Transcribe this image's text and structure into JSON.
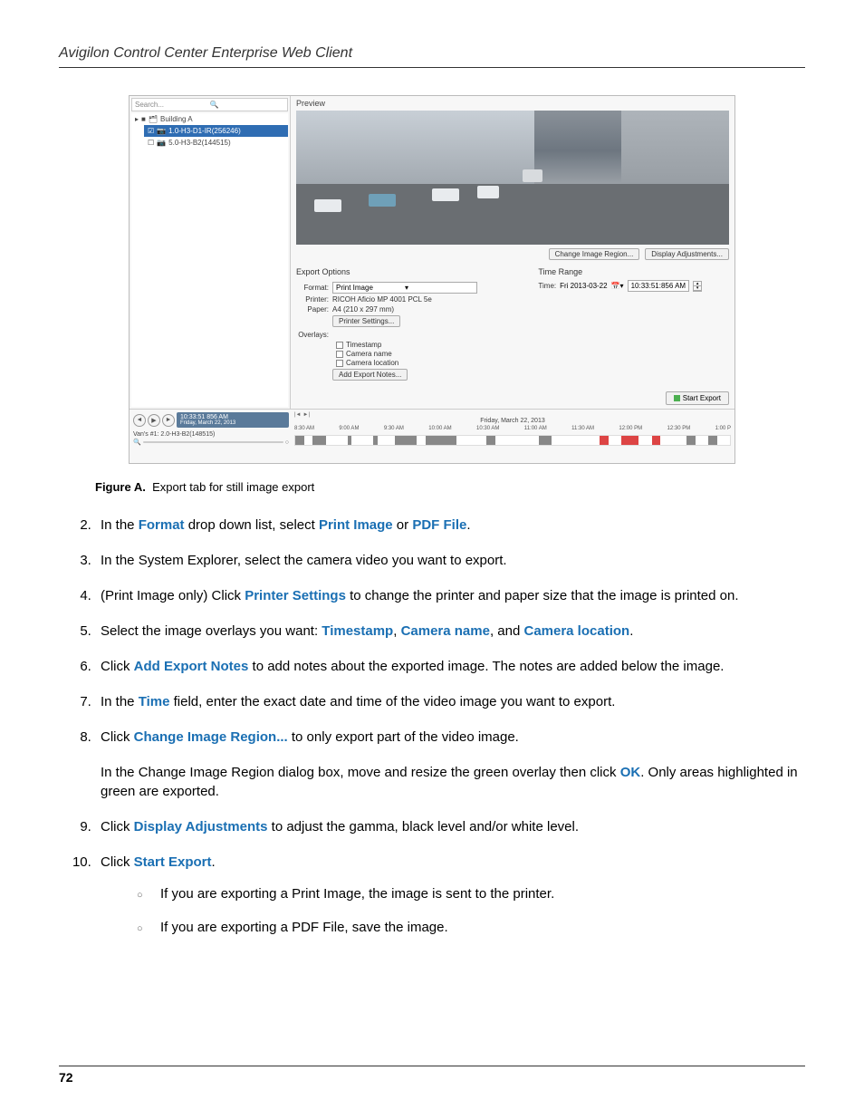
{
  "header": "Avigilon Control Center Enterprise Web Client",
  "page_number": "72",
  "screenshot": {
    "search_placeholder": "Search...",
    "tree": {
      "root": "Building A",
      "selected": "1.0-H3-D1-IR(256246)",
      "other": "5.0-H3-B2(144515)"
    },
    "preview_label": "Preview",
    "change_region_btn": "Change Image Region...",
    "display_adj_btn": "Display Adjustments...",
    "export_options_title": "Export Options",
    "time_range_title": "Time Range",
    "format_label": "Format:",
    "format_value": "Print Image",
    "printer_label": "Printer:",
    "printer_value": "RICOH Aficio MP 4001 PCL 5e",
    "paper_label": "Paper:",
    "paper_value": "A4 (210 x 297 mm)",
    "printer_settings_btn": "Printer Settings...",
    "overlays_label": "Overlays:",
    "overlay_timestamp": "Timestamp",
    "overlay_cam_name": "Camera name",
    "overlay_cam_loc": "Camera location",
    "add_notes_btn": "Add Export Notes...",
    "time_label": "Time:",
    "time_date": "Fri 2013-03-22",
    "time_value": "10:33:51:856 AM",
    "start_export_btn": "Start Export",
    "timeline": {
      "badge_time": "10:33:51 856 AM",
      "badge_date": "Friday, March 22, 2013",
      "date_heading": "Friday, March 22, 2013",
      "cam_label": "Van's #1: 2.0-H3-B2(148515)",
      "hours": [
        "8:30 AM",
        "9:00 AM",
        "9:30 AM",
        "10:00 AM",
        "10:30 AM",
        "11:00 AM",
        "11:30 AM",
        "12:00 PM",
        "12:30 PM",
        "1:00 P"
      ]
    }
  },
  "caption_label": "Figure A.",
  "caption_text": "Export tab for still image export",
  "steps": {
    "s2a": "In the ",
    "s2b": " drop down list, select ",
    "s2c": " or ",
    "s2d": ".",
    "kw_format": "Format",
    "kw_printimage": "Print Image",
    "kw_pdffile": "PDF File",
    "s3": "In the System Explorer, select the camera video you want to export.",
    "s4a": "(Print Image only) Click ",
    "kw_printer_settings": "Printer Settings",
    "s4b": " to change the printer and paper size that the image is printed on.",
    "s5a": "Select the image overlays you want: ",
    "kw_timestamp": "Timestamp",
    "s5b": ", ",
    "kw_cam_name": "Camera name",
    "s5c": ", and ",
    "kw_cam_loc": "Camera location",
    "s5d": ".",
    "s6a": "Click ",
    "kw_add_notes": "Add Export Notes",
    "s6b": " to add notes about the exported image. The notes are added below the image.",
    "s7a": "In the ",
    "kw_time": "Time",
    "s7b": " field, enter the exact date and time of the video image you want to export.",
    "s8a": "Click ",
    "kw_change_region": "Change Image Region...",
    "s8b": " to only export part of the video image.",
    "s8c_a": "In the Change Image Region dialog box, move and resize the green overlay then click ",
    "kw_ok": "OK",
    "s8c_b": ". Only areas highlighted in green are exported.",
    "s9a": "Click ",
    "kw_disp_adj": "Display Adjustments",
    "s9b": " to adjust the gamma, black level and/or white level.",
    "s10a": "Click ",
    "kw_start_export": "Start Export",
    "s10b": ".",
    "sub1": "If you are exporting a Print Image, the image is sent to the printer.",
    "sub2": "If you are exporting a PDF File, save the image."
  }
}
